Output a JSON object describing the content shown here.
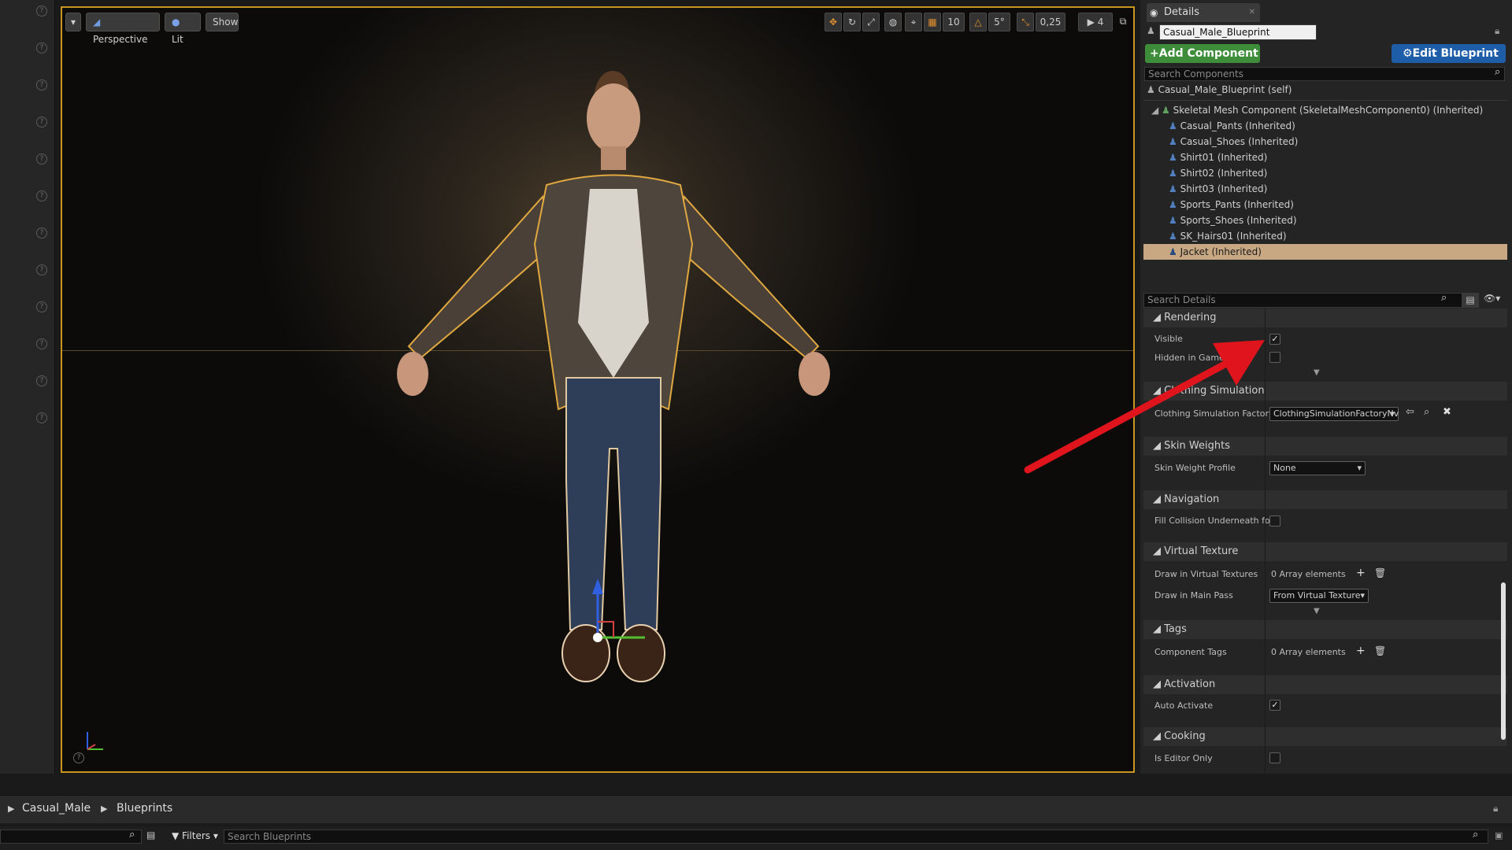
{
  "viewport": {
    "perspective_label": "Perspective",
    "lit_label": "Lit",
    "show_label": "Show",
    "grid_snap": "10",
    "rotation_snap": "5°",
    "scale_snap": "0,25",
    "camera_speed": "4"
  },
  "details": {
    "tab_label": "Details",
    "actor_name": "Casual_Male_Blueprint",
    "add_component_label": "Add Component",
    "edit_blueprint_label": "Edit Blueprint",
    "search_components_placeholder": "Search Components",
    "search_details_placeholder": "Search Details",
    "self_item": "Casual_Male_Blueprint (self)",
    "components": [
      "Skeletal Mesh Component (SkeletalMeshComponent0) (Inherited)",
      "Casual_Pants (Inherited)",
      "Casual_Shoes (Inherited)",
      "Shirt01 (Inherited)",
      "Shirt02 (Inherited)",
      "Shirt03 (Inherited)",
      "Sports_Pants (Inherited)",
      "Sports_Shoes (Inherited)",
      "SK_Hairs01 (Inherited)",
      "Jacket (Inherited)"
    ],
    "selected_color": "#c8a882",
    "categories": {
      "rendering": "Rendering",
      "visible": "Visible",
      "hidden_in_game": "Hidden in Game",
      "clothing_simulation": "Clothing Simulation",
      "clothing_simulation_factory": "Clothing Simulation Factory",
      "clothing_factory_value": "ClothingSimulationFactoryNv",
      "skin_weights": "Skin Weights",
      "skin_weight_profile": "Skin Weight Profile",
      "skin_weight_value": "None",
      "navigation": "Navigation",
      "fill_collision": "Fill Collision Underneath for",
      "virtual_texture": "Virtual Texture",
      "draw_in_virtual_textures": "Draw in Virtual Textures",
      "array_elements": "0 Array elements",
      "draw_in_main_pass": "Draw in Main Pass",
      "draw_in_main_pass_value": "From Virtual Texture",
      "tags": "Tags",
      "component_tags": "Component Tags",
      "component_tags_value": "0 Array elements",
      "activation": "Activation",
      "auto_activate": "Auto Activate",
      "cooking": "Cooking",
      "is_editor_only": "Is Editor Only"
    }
  },
  "content_browser": {
    "breadcrumb_root": "Casual_Male",
    "breadcrumb_folder": "Blueprints",
    "filters_label": "Filters",
    "search_placeholder": "Search Blueprints"
  },
  "annotation_color": "#e0141c"
}
